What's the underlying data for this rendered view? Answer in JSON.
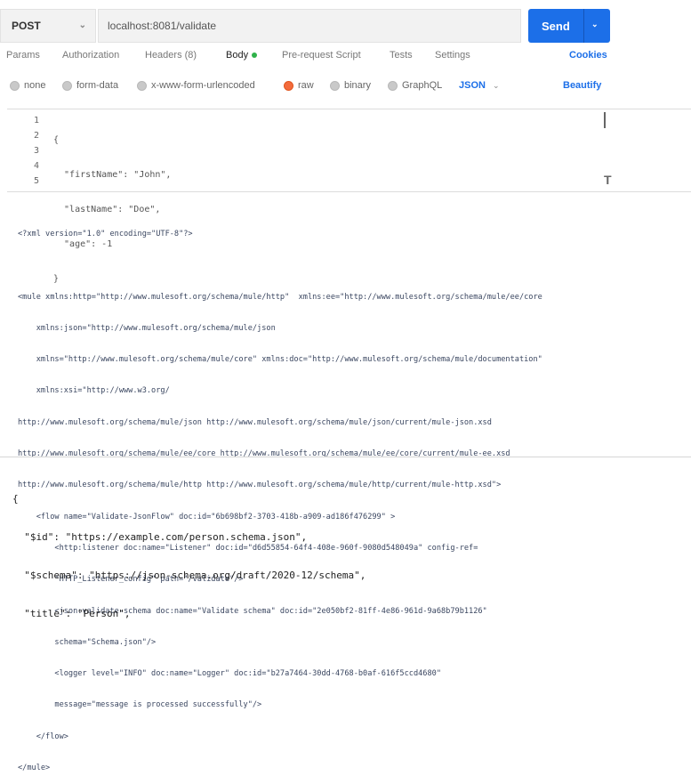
{
  "request": {
    "method": "POST",
    "url": "localhost:8081/validate",
    "send_label": "Send"
  },
  "tabs": [
    {
      "label": "Params"
    },
    {
      "label": "Authorization"
    },
    {
      "label": "Headers (8)"
    },
    {
      "label": "Body"
    },
    {
      "label": "Pre-request Script"
    },
    {
      "label": "Tests"
    },
    {
      "label": "Settings"
    }
  ],
  "cookies_label": "Cookies",
  "body_options": [
    {
      "label": "none"
    },
    {
      "label": "form-data"
    },
    {
      "label": "x-www-form-urlencoded"
    },
    {
      "label": "raw"
    },
    {
      "label": "binary"
    },
    {
      "label": "GraphQL"
    }
  ],
  "format_select": "JSON",
  "beautify_label": "Beautify",
  "editor": {
    "line_numbers": [
      "1",
      "2",
      "3",
      "4",
      "5"
    ],
    "lines": [
      "{",
      "  \"firstName\": \"John\",",
      "  \"lastName\": \"Doe\",",
      "  \"age\": -1",
      "}"
    ]
  },
  "xml_lines": [
    "<?xml version=\"1.0\" encoding=\"UTF-8\"?>",
    "",
    "<mule xmlns:http=\"http://www.mulesoft.org/schema/mule/http\"  xmlns:ee=\"http://www.mulesoft.org/schema/mule/ee/core",
    "    xmlns:json=\"http://www.mulesoft.org/schema/mule/json",
    "    xmlns=\"http://www.mulesoft.org/schema/mule/core\" xmlns:doc=\"http://www.mulesoft.org/schema/mule/documentation\"",
    "    xmlns:xsi=\"http://www.w3.org/",
    "http://www.mulesoft.org/schema/mule/json http://www.mulesoft.org/schema/mule/json/current/mule-json.xsd",
    "http://www.mulesoft.org/schema/mule/ee/core http://www.mulesoft.org/schema/mule/ee/core/current/mule-ee.xsd",
    "http://www.mulesoft.org/schema/mule/http http://www.mulesoft.org/schema/mule/http/current/mule-http.xsd\">",
    "    <flow name=\"Validate-JsonFlow\" doc:id=\"6b698bf2-3703-418b-a909-ad186f476299\" >",
    "        <http:listener doc:name=\"Listener\" doc:id=\"d6d55854-64f4-408e-960f-9080d548049a\" config-ref=",
    "        \"HTTP_Listener_config\" path=\"/validate\"/>",
    "        <json:validate-schema doc:name=\"Validate schema\" doc:id=\"2e050bf2-81ff-4e86-961d-9a68b79b1126\"",
    "        schema=\"Schema.json\"/>",
    "        <logger level=\"INFO\" doc:name=\"Logger\" doc:id=\"b27a7464-30dd-4768-b0af-616f5ccd4680\"",
    "        message=\"message is processed successfully\"/>",
    "    </flow>",
    "</mule>"
  ],
  "schema_lines": [
    "{",
    "  \"$id\": \"https://example.com/person.schema.json\",",
    "  \"$schema\": \"https://json-schema.org/draft/2020-12/schema\",",
    "  \"title\": \"Person\","
  ],
  "colors": {
    "send": "#1c6fe8",
    "link": "#1c6fe8",
    "body_dot": "#2fb24a",
    "raw_radio": "#f36b3c"
  }
}
